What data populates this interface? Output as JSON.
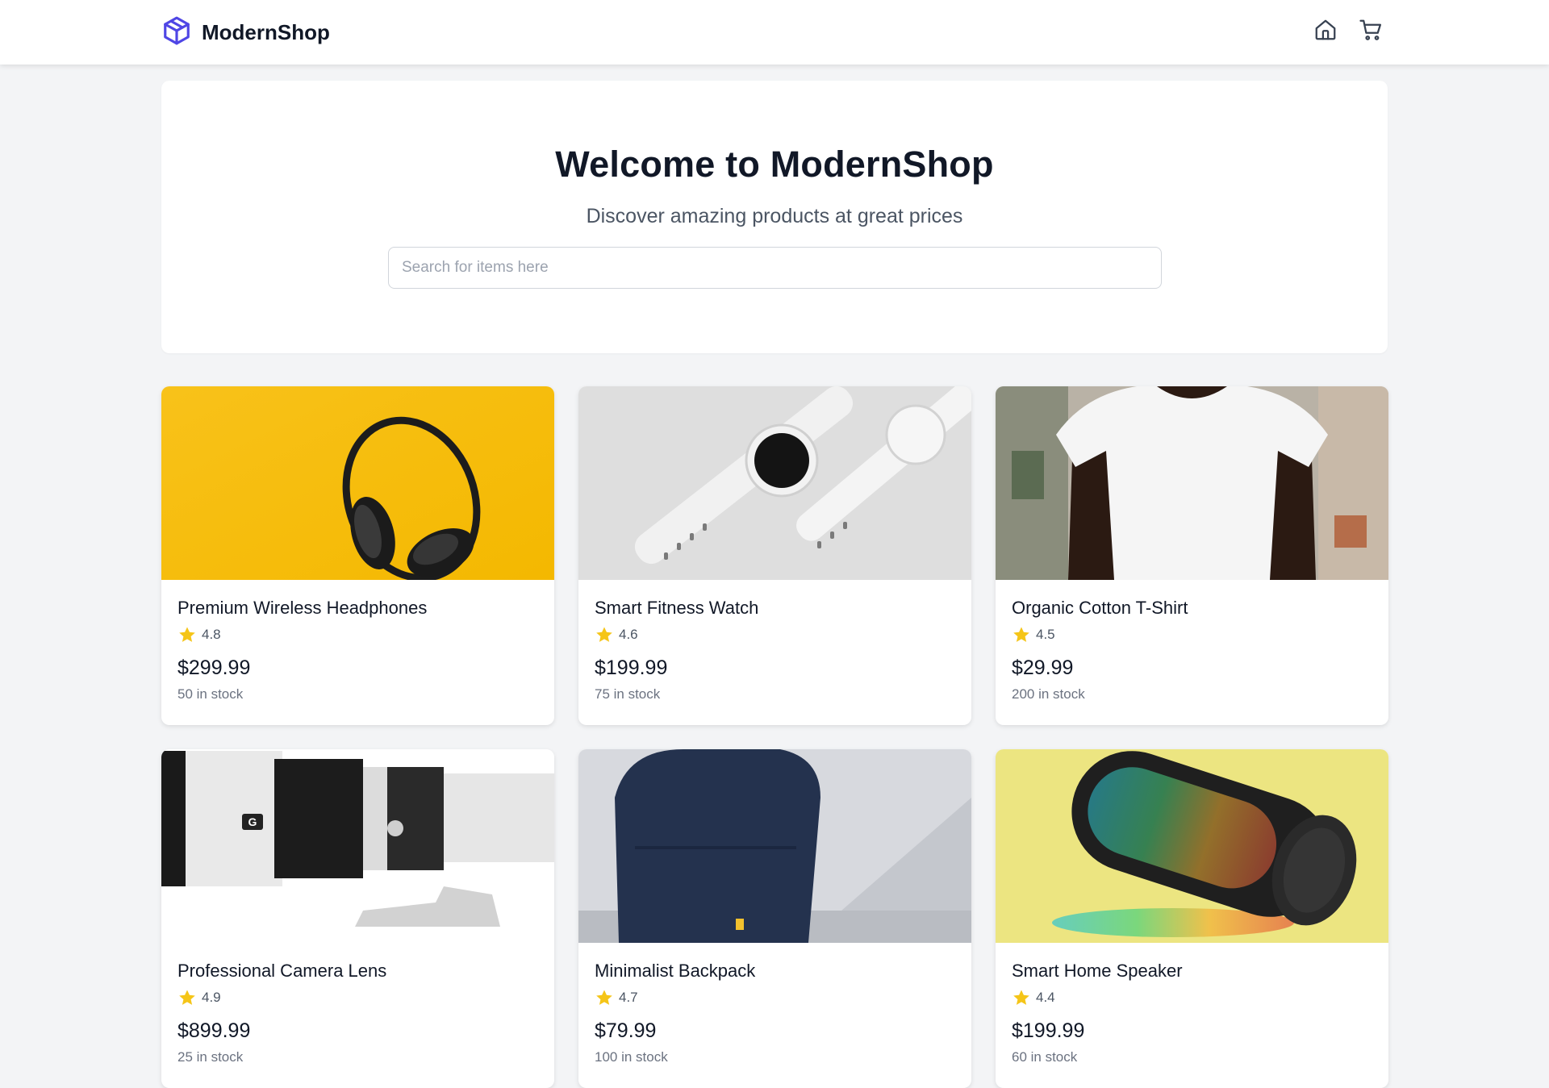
{
  "header": {
    "brand": "ModernShop",
    "icons": [
      "cube-icon",
      "home-icon",
      "cart-icon"
    ]
  },
  "hero": {
    "title": "Welcome to ModernShop",
    "subtitle": "Discover amazing products at great prices",
    "search_placeholder": "Search for items here",
    "search_value": ""
  },
  "colors": {
    "brand_accent": "#4f46e5",
    "star": "#f5c518",
    "page_bg": "#f3f4f6"
  },
  "products": [
    {
      "name": "Premium Wireless Headphones",
      "rating": "4.8",
      "price": "$299.99",
      "stock": "50 in stock",
      "image": "headphones-image"
    },
    {
      "name": "Smart Fitness Watch",
      "rating": "4.6",
      "price": "$199.99",
      "stock": "75 in stock",
      "image": "watch-image"
    },
    {
      "name": "Organic Cotton T-Shirt",
      "rating": "4.5",
      "price": "$29.99",
      "stock": "200 in stock",
      "image": "tshirt-image"
    },
    {
      "name": "Professional Camera Lens",
      "rating": "4.9",
      "price": "$899.99",
      "stock": "25 in stock",
      "image": "camera-lens-image"
    },
    {
      "name": "Minimalist Backpack",
      "rating": "4.7",
      "price": "$79.99",
      "stock": "100 in stock",
      "image": "backpack-image"
    },
    {
      "name": "Smart Home Speaker",
      "rating": "4.4",
      "price": "$199.99",
      "stock": "60 in stock",
      "image": "speaker-image"
    }
  ]
}
